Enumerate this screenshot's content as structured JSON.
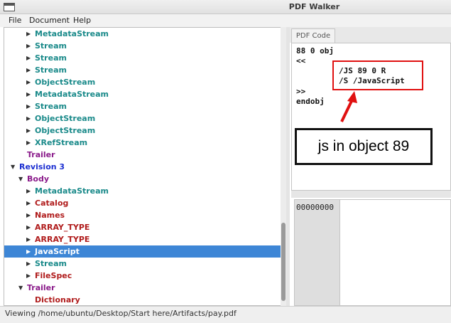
{
  "window": {
    "title": "PDF Walker"
  },
  "menu": [
    "File",
    "Document",
    "Help"
  ],
  "tree": [
    {
      "label": "MetadataStream",
      "arrow": "▶",
      "color": "teal"
    },
    {
      "label": "Stream",
      "arrow": "▶",
      "color": "teal"
    },
    {
      "label": "Stream",
      "arrow": "▶",
      "color": "teal"
    },
    {
      "label": "Stream",
      "arrow": "▶",
      "color": "teal"
    },
    {
      "label": "ObjectStream",
      "arrow": "▶",
      "color": "teal"
    },
    {
      "label": "MetadataStream",
      "arrow": "▶",
      "color": "teal"
    },
    {
      "label": "Stream",
      "arrow": "▶",
      "color": "teal"
    },
    {
      "label": "ObjectStream",
      "arrow": "▶",
      "color": "teal"
    },
    {
      "label": "ObjectStream",
      "arrow": "▶",
      "color": "teal"
    },
    {
      "label": "XRefStream",
      "arrow": "▶",
      "color": "teal"
    },
    {
      "label": "Trailer",
      "arrow": "",
      "color": "purple"
    },
    {
      "label": "Revision 3",
      "arrow": "▼",
      "color": "blue"
    },
    {
      "label": "Body",
      "arrow": "▼",
      "color": "purple"
    },
    {
      "label": "MetadataStream",
      "arrow": "▶",
      "color": "teal"
    },
    {
      "label": "Catalog",
      "arrow": "▶",
      "color": "red"
    },
    {
      "label": "Names",
      "arrow": "▶",
      "color": "red"
    },
    {
      "label": "ARRAY_TYPE",
      "arrow": "▶",
      "color": "red"
    },
    {
      "label": "ARRAY_TYPE",
      "arrow": "▶",
      "color": "red"
    },
    {
      "label": "JavaScript",
      "arrow": "▶",
      "color": "red",
      "selected": true
    },
    {
      "label": "Stream",
      "arrow": "▶",
      "color": "teal"
    },
    {
      "label": "FileSpec",
      "arrow": "▶",
      "color": "red"
    },
    {
      "label": "Trailer",
      "arrow": "▼",
      "color": "purple"
    },
    {
      "label": "Dictionary",
      "arrow": "",
      "color": "red"
    }
  ],
  "code_tab": "PDF Code",
  "code_lines": [
    "88 0 obj",
    "<<",
    "/JS 89 0 R",
    "/S /JavaScript",
    ">>",
    "endobj"
  ],
  "annotation": {
    "text": "js in object 89"
  },
  "hex": {
    "offset": "00000000"
  },
  "status": {
    "text": "Viewing /home/ubuntu/Desktop/Start here/Artifacts/pay.pdf"
  },
  "colors": {
    "highlight": "#e01010",
    "selection": "#3d86d6",
    "teal": "#1a8a8a",
    "purple": "#8a1a8a",
    "blue": "#1c2fd1",
    "red": "#b01c1c"
  }
}
